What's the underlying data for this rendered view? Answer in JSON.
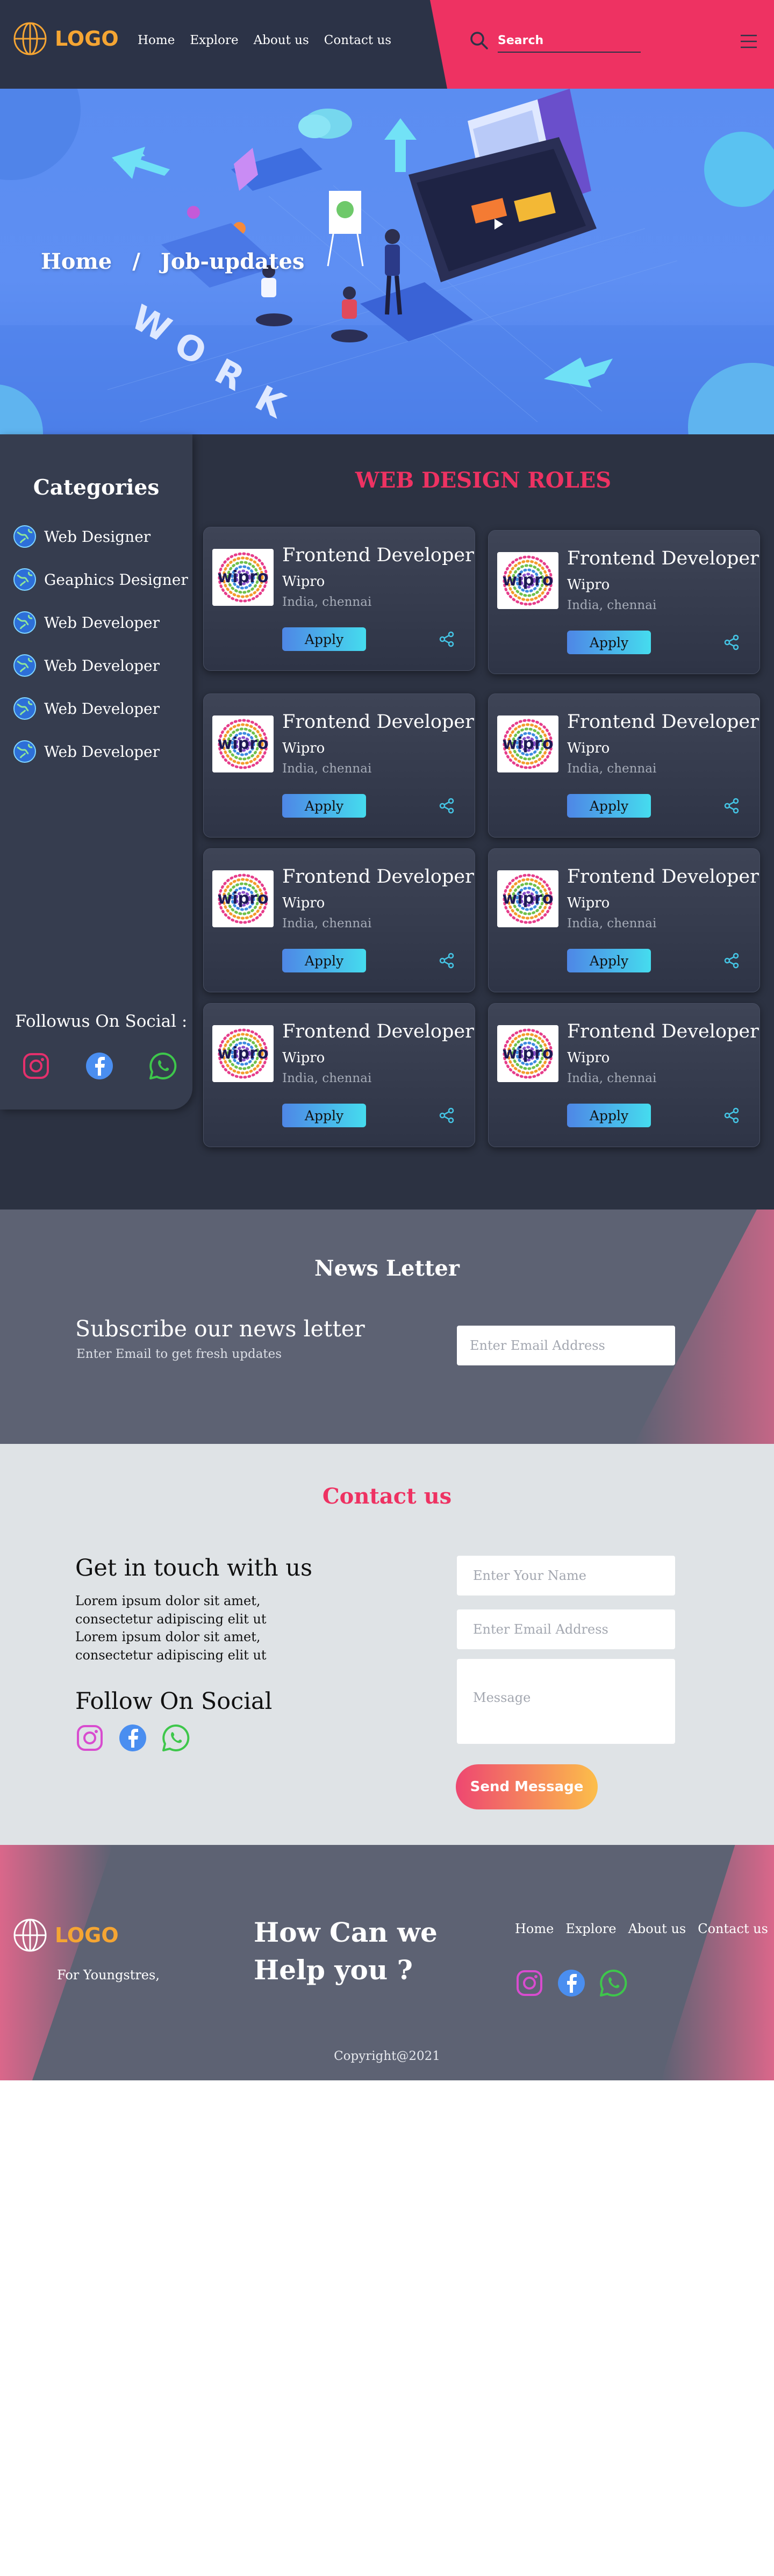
{
  "header": {
    "logo": "LOGO",
    "nav": [
      "Home",
      "Explore",
      "About us",
      "Contact us"
    ],
    "search_placeholder": "Search",
    "colors": {
      "bar": "#2c3347",
      "accent": "#ee3262",
      "logo": "#f5a533"
    }
  },
  "hero": {
    "breadcrumb": [
      "Home",
      "/",
      "Job-updates"
    ],
    "illustration_text": "WORK"
  },
  "sidebar": {
    "title": "Categories",
    "categories": [
      "Web Designer",
      "Geaphics Designer",
      "Web Developer",
      "Web Developer",
      "Web Developer",
      "Web Developer"
    ],
    "follow_title": "Followus On Social :",
    "social_icons": [
      "instagram-icon",
      "facebook-icon",
      "whatsapp-icon"
    ]
  },
  "roles": {
    "title": "WEB DESIGN ROLES",
    "jobs": [
      {
        "title": "Frontend Developer",
        "company": "Wipro",
        "location": "India, chennai",
        "apply": "Apply",
        "logo_text": "wipro"
      },
      {
        "title": "Frontend Developer",
        "company": "Wipro",
        "location": "India, chennai",
        "apply": "Apply",
        "logo_text": "wipro"
      },
      {
        "title": "Frontend Developer",
        "company": "Wipro",
        "location": "India, chennai",
        "apply": "Apply",
        "logo_text": "wipro"
      },
      {
        "title": "Frontend Developer",
        "company": "Wipro",
        "location": "India, chennai",
        "apply": "Apply",
        "logo_text": "wipro"
      },
      {
        "title": "Frontend Developer",
        "company": "Wipro",
        "location": "India, chennai",
        "apply": "Apply",
        "logo_text": "wipro"
      },
      {
        "title": "Frontend Developer",
        "company": "Wipro",
        "location": "India, chennai",
        "apply": "Apply",
        "logo_text": "wipro"
      },
      {
        "title": "Frontend Developer",
        "company": "Wipro",
        "location": "India, chennai",
        "apply": "Apply",
        "logo_text": "wipro"
      },
      {
        "title": "Frontend Developer",
        "company": "Wipro",
        "location": "India, chennai",
        "apply": "Apply",
        "logo_text": "wipro"
      }
    ]
  },
  "newsletter": {
    "title": "News Letter",
    "subtitle": "Subscribe our news letter",
    "small": "Enter Email to get fresh updates",
    "email_placeholder": "Enter Email Address"
  },
  "contact": {
    "title": "Contact us",
    "heading": "Get in touch with us",
    "body": "Lorem ipsum dolor sit amet, consectetur adipiscing elit ut Lorem ipsum dolor sit amet, consectetur adipiscing elit ut",
    "follow": "Follow On Social",
    "name_placeholder": "Enter Your Name",
    "email_placeholder": "Enter Email Address",
    "message_placeholder": "Message",
    "send": "Send Message"
  },
  "footer": {
    "logo": "LOGO",
    "tagline": "For Youngstres,",
    "help_line1": "How Can we",
    "help_line2": "Help you ?",
    "links": [
      "Home",
      "Explore",
      "About us",
      "Contact us"
    ],
    "copyright": "Copyright@2021"
  }
}
